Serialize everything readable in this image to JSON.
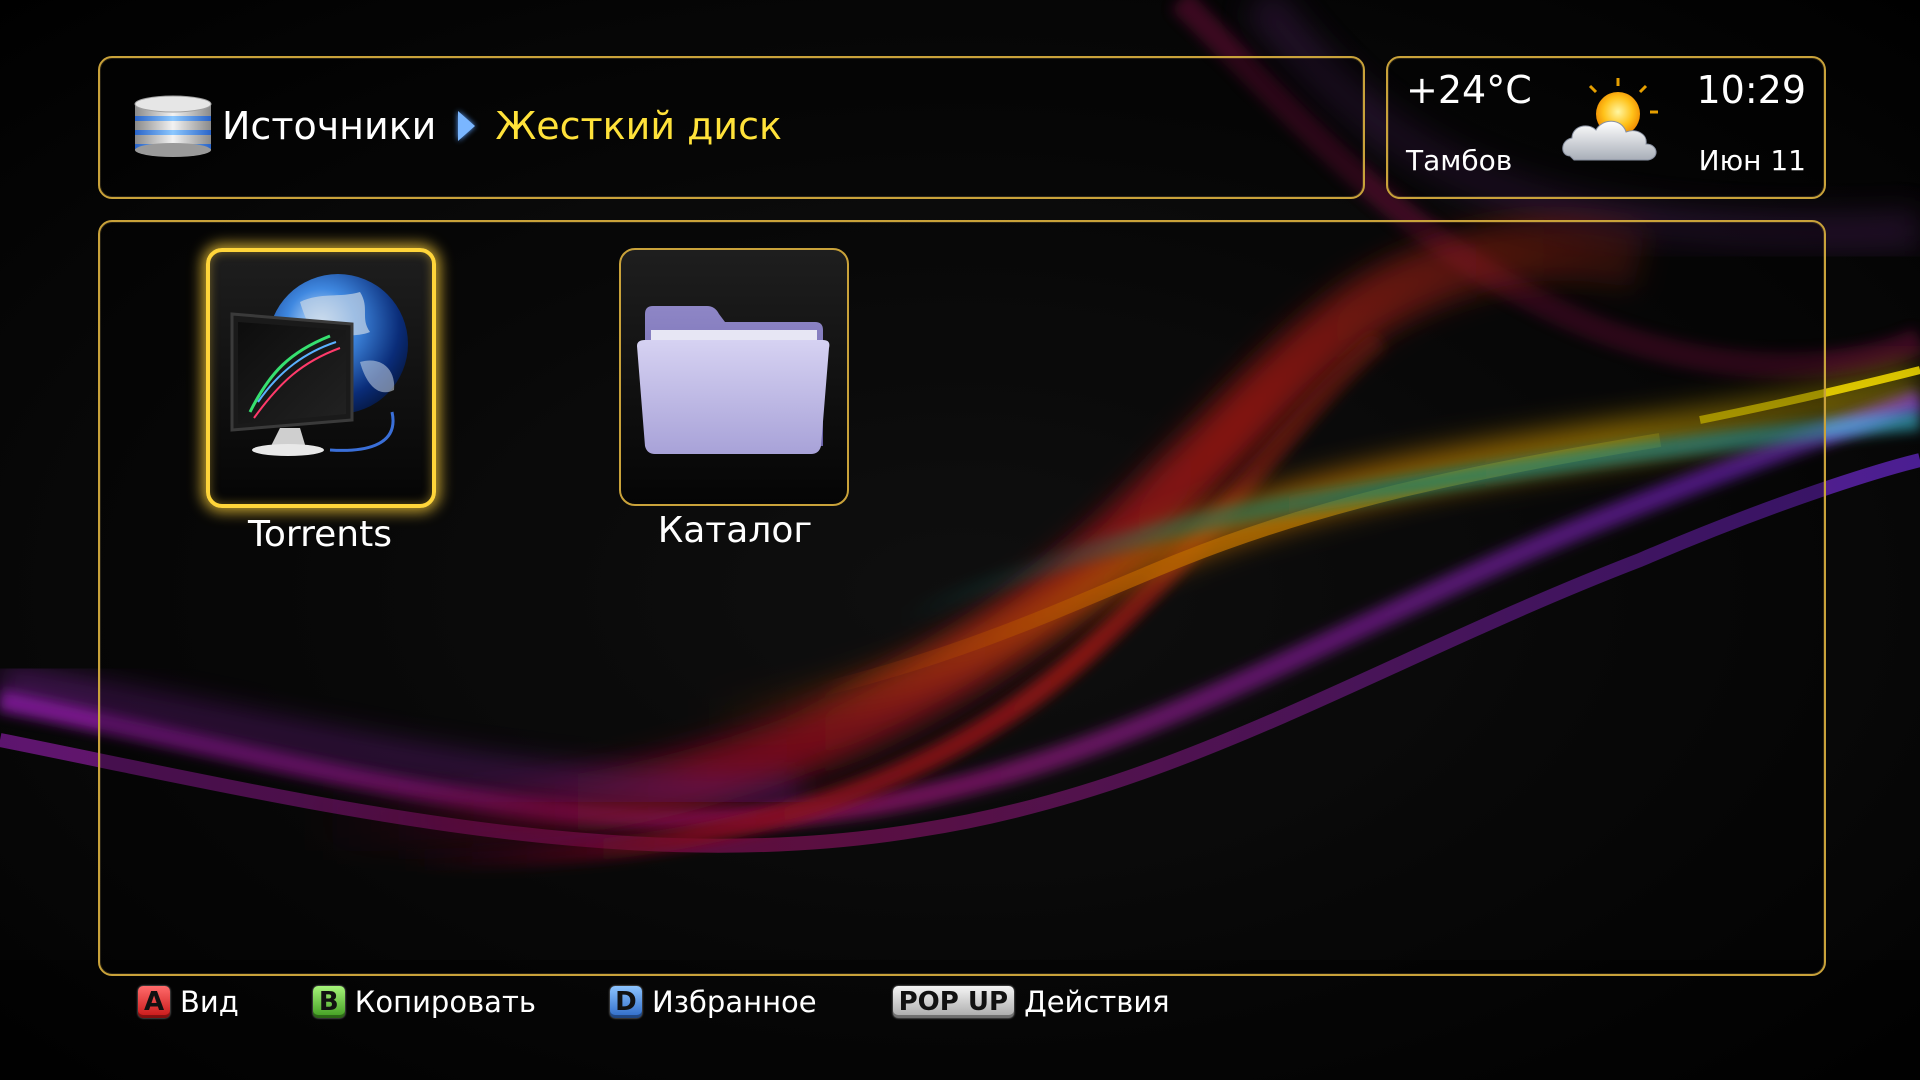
{
  "breadcrumb": {
    "root": "Источники",
    "current": "Жесткий диск"
  },
  "weather": {
    "temperature": "+24°C",
    "city": "Тамбов",
    "time": "10:29",
    "date": "Июн 11",
    "icon": "partly-cloudy-icon"
  },
  "tiles": [
    {
      "label": "Torrents",
      "icon": "globe-monitor-icon",
      "focused": true
    },
    {
      "label": "Каталог",
      "icon": "folder-icon",
      "focused": false
    }
  ],
  "footer": [
    {
      "key": "A",
      "label": "Вид",
      "color": "#e02020"
    },
    {
      "key": "B",
      "label": "Копировать",
      "color": "#4caf2a"
    },
    {
      "key": "D",
      "label": "Избранное",
      "color": "#3a7bd5"
    },
    {
      "key": "POP UP",
      "label": "Действия",
      "color": "#cccccc"
    }
  ],
  "colors": {
    "accent": "#ffe23a",
    "frame": "#c9a23a"
  }
}
